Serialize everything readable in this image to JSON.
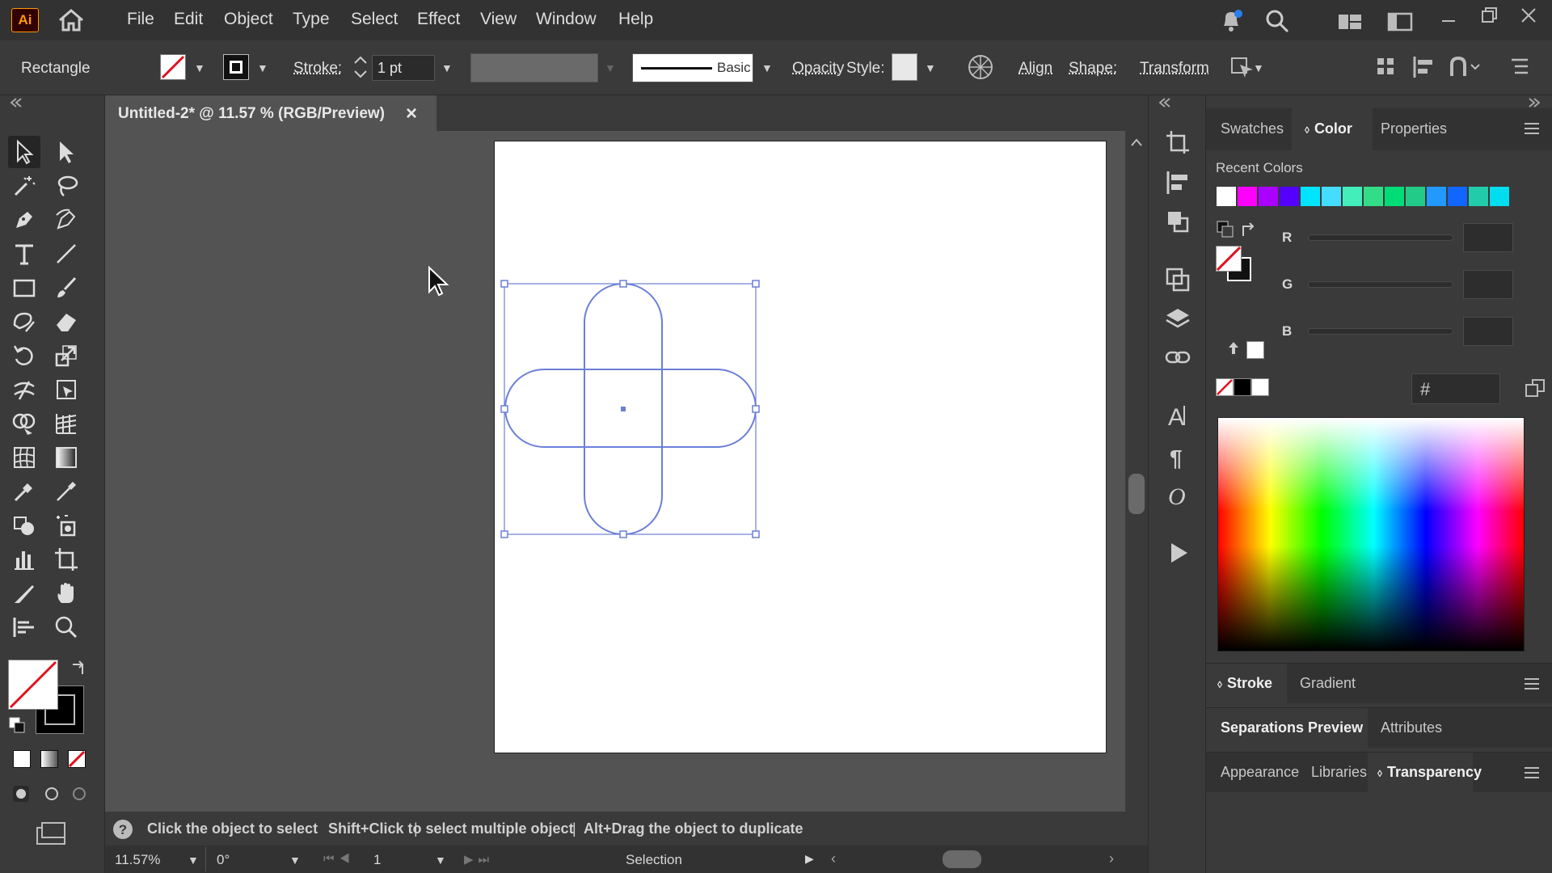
{
  "app": {
    "logo": "Ai"
  },
  "menu": [
    "File",
    "Edit",
    "Object",
    "Type",
    "Select",
    "Effect",
    "View",
    "Window",
    "Help"
  ],
  "control": {
    "object_type": "Rectangle",
    "stroke_label": "Stroke:",
    "stroke_value": "1 pt",
    "brush_label": "Basic",
    "opacity_label": "Opacity",
    "style_label": "Style:",
    "align_label": "Align",
    "shape_label": "Shape:",
    "transform_label": "Transform"
  },
  "document": {
    "tab_title": "Untitled-2* @ 11.57 % (RGB/Preview)",
    "close": "×"
  },
  "status": {
    "hint_1": "Click the object to select",
    "hint_2": "Shift+Click to select multiple object",
    "hint_3": "Alt+Drag the object to duplicate",
    "sep": "|"
  },
  "bottom": {
    "zoom": "11.57%",
    "rotation": "0°",
    "artboard": "1",
    "mode": "Selection"
  },
  "panel": {
    "tabs": [
      "Swatches",
      "Color",
      "Properties"
    ],
    "recent_colors_label": "Recent Colors",
    "recent_colors": [
      "#ffffff",
      "#ff00ff",
      "#aa00ff",
      "#5500ff",
      "#00e5ff",
      "#44ddff",
      "#44eebb",
      "#33dd88",
      "#00dd77",
      "#22cc88",
      "#2299ff",
      "#1166ff",
      "#22ccaa",
      "#00ddee"
    ],
    "r_label": "R",
    "g_label": "G",
    "b_label": "B",
    "hex_label": "#"
  },
  "sections": {
    "stroke_tab": "Stroke",
    "gradient_tab": "Gradient",
    "sep_tab": "Separations Preview",
    "attributes_tab": "Attributes",
    "appearance_tab": "Appearance",
    "libraries_tab": "Libraries",
    "transparency_tab": "Transparency"
  },
  "colors": {
    "selection": "#6b7fd7",
    "bg": "#535353"
  }
}
